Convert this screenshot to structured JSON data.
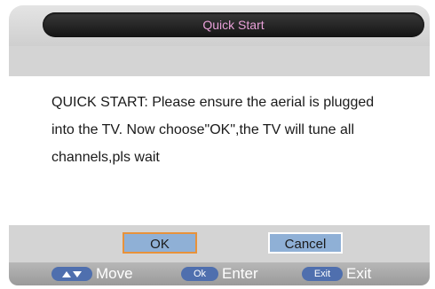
{
  "dialog": {
    "title": "Quick Start",
    "message_lines": [
      "QUICK START: Please ensure the aerial  is plugged",
      "into the TV. Now  choose\"OK\",the TV will tune all",
      "channels,pls wait"
    ],
    "ok_label": "OK",
    "cancel_label": "Cancel"
  },
  "help_bar": {
    "move": {
      "key_icon": "up-down-arrows-icon",
      "label": "Move"
    },
    "enter": {
      "key": "Ok",
      "label": "Enter"
    },
    "exit": {
      "key": "Exit",
      "label": "Exit"
    }
  },
  "colors": {
    "title_text": "#e8a0d8",
    "button_fill": "#8fb0d6",
    "focus_border": "#e8923a",
    "key_pill": "#4f6fae"
  }
}
